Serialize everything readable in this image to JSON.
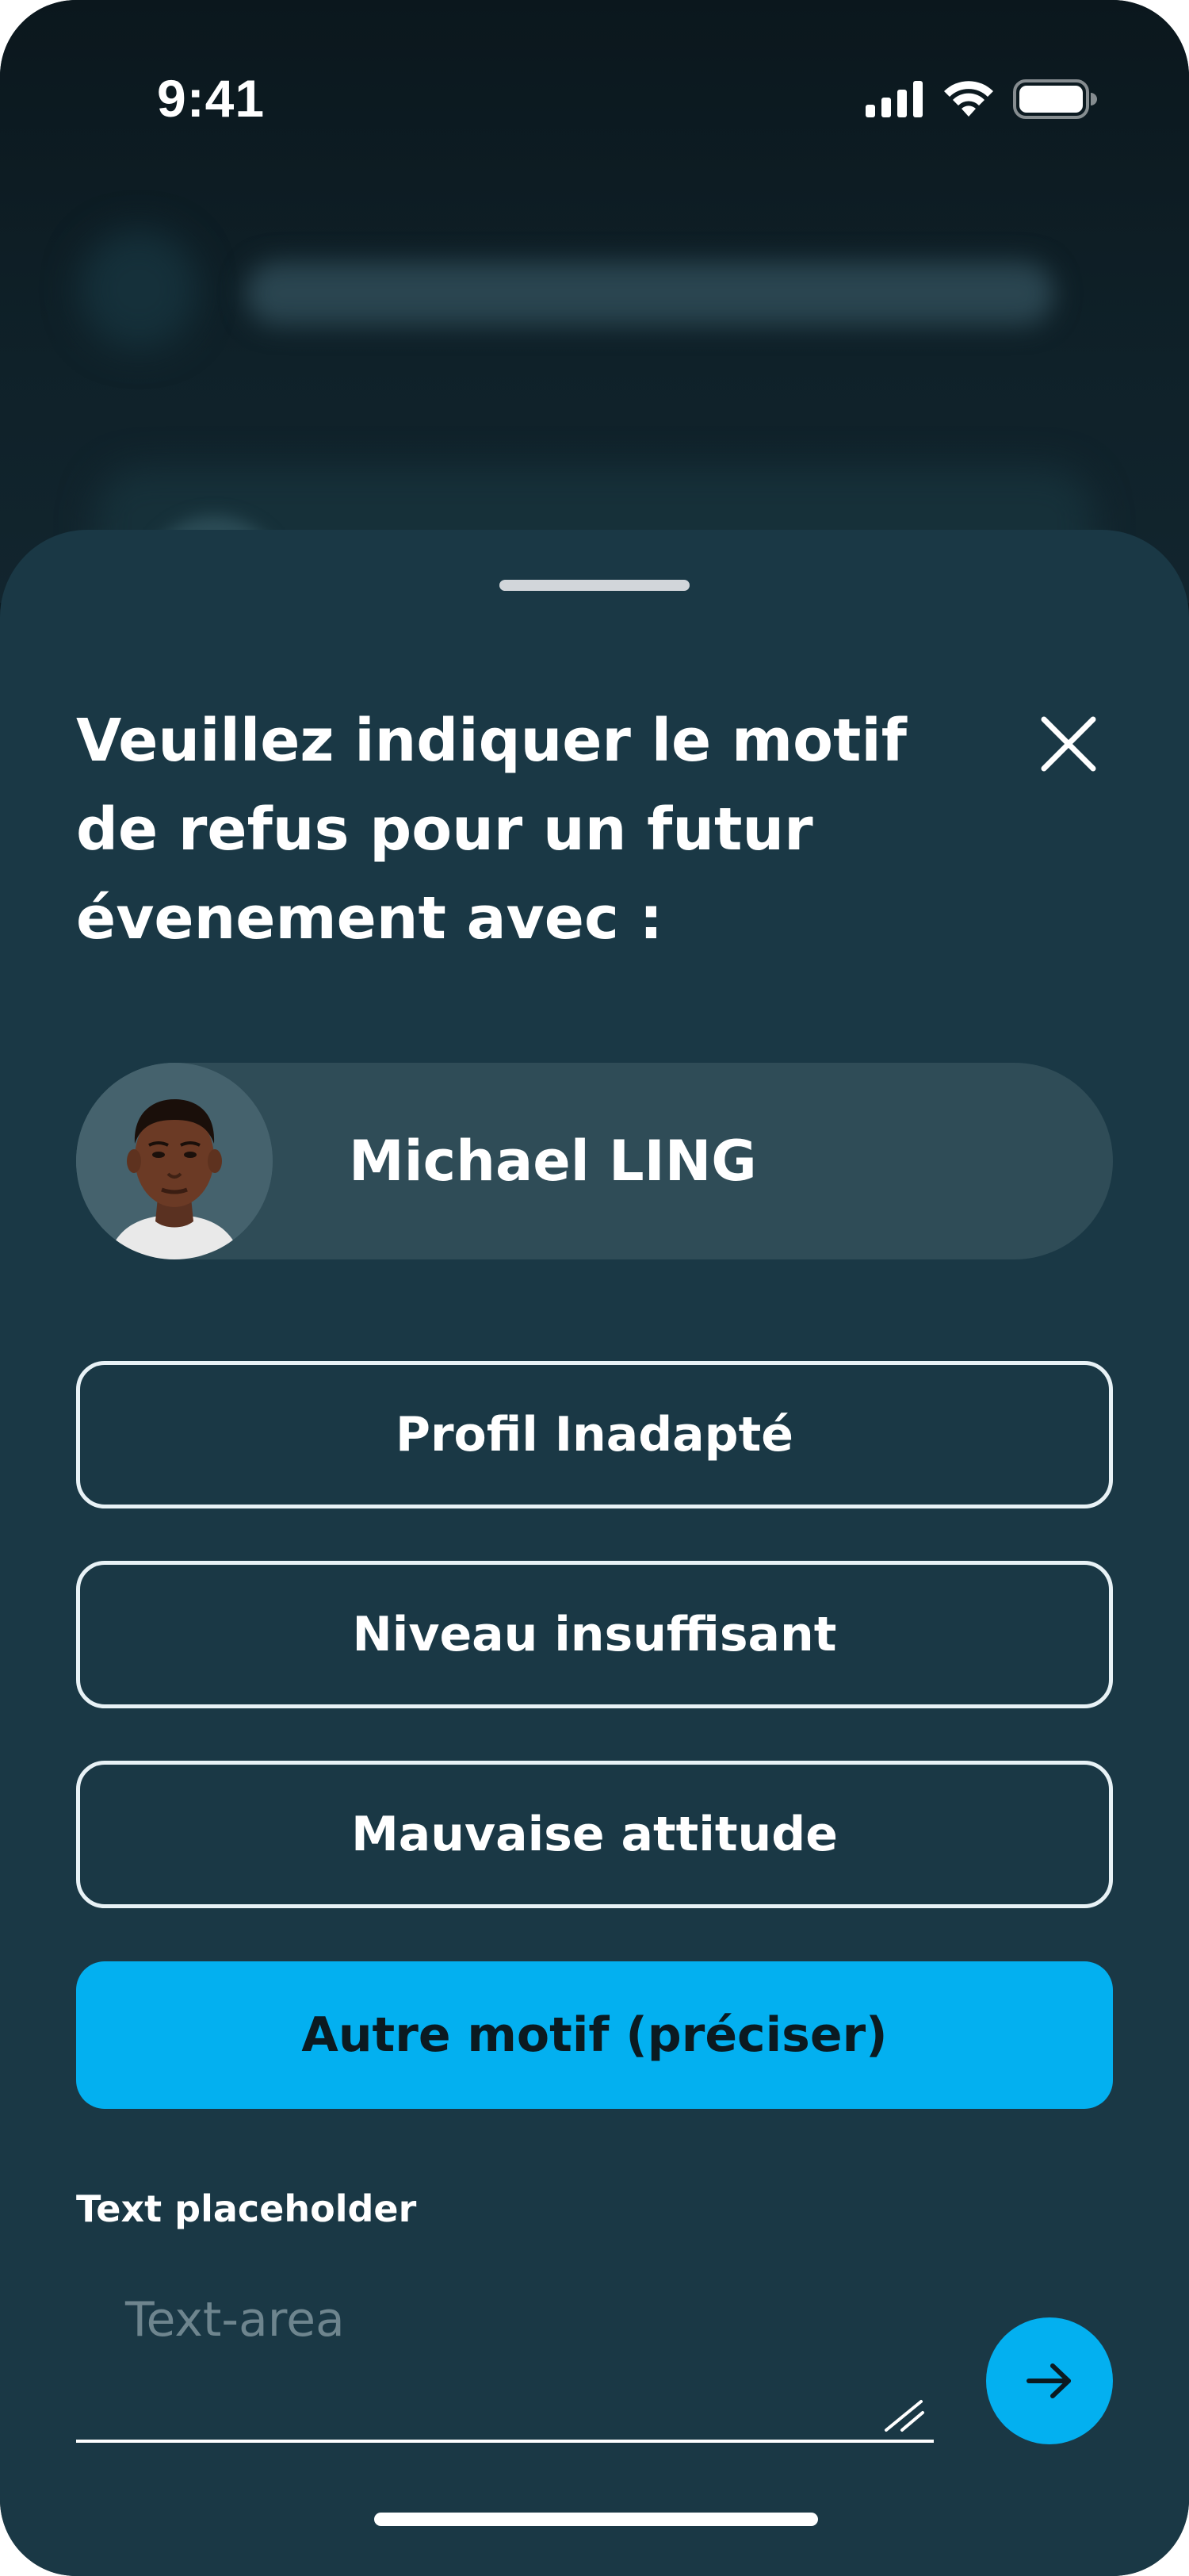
{
  "status_bar": {
    "time": "9:41"
  },
  "sheet": {
    "title": "Veuillez indiquer le motif de refus pour un futur évenement avec :",
    "close_icon": "close-icon"
  },
  "player": {
    "name": "Michael LING",
    "avatar_icon": "avatar"
  },
  "reasons": [
    {
      "label": "Profil Inadapté",
      "selected": false
    },
    {
      "label": "Niveau insuffisant",
      "selected": false
    },
    {
      "label": "Mauvaise attitude",
      "selected": false
    },
    {
      "label": "Autre motif (préciser)",
      "selected": true
    }
  ],
  "comment": {
    "label": "Text placeholder",
    "placeholder": "Text-area"
  },
  "send_icon": "arrow-right-icon",
  "colors": {
    "sheet_background": "#1a3845",
    "accent": "#03b0f0",
    "card_background": "#2f4c57",
    "text": "#ffffff"
  }
}
